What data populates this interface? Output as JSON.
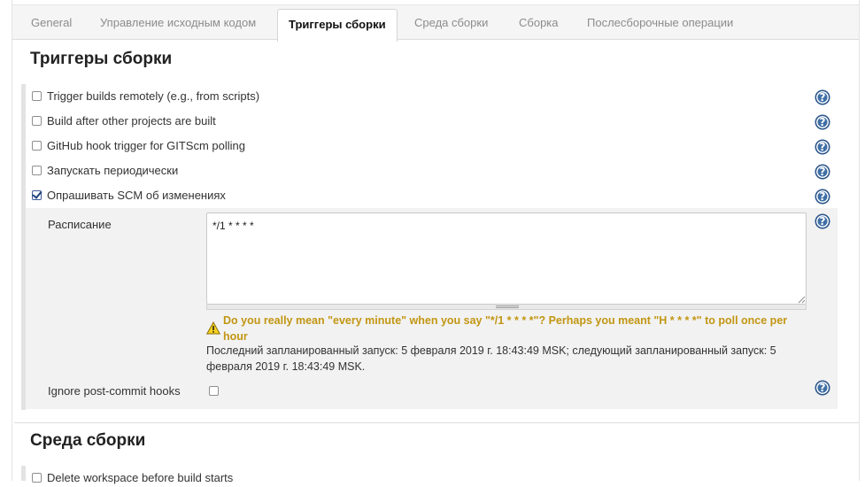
{
  "tabs": [
    {
      "label": "General"
    },
    {
      "label": "Управление исходным кодом"
    },
    {
      "label": "Триггеры сборки",
      "active": true
    },
    {
      "label": "Среда сборки"
    },
    {
      "label": "Сборка"
    },
    {
      "label": "Послесборочные операции"
    }
  ],
  "triggers": {
    "title": "Триггеры сборки",
    "options": [
      {
        "label": "Trigger builds remotely (e.g., from scripts)",
        "checked": false
      },
      {
        "label": "Build after other projects are built",
        "checked": false
      },
      {
        "label": "GitHub hook trigger for GITScm polling",
        "checked": false
      },
      {
        "label": "Запускать периодически",
        "checked": false
      },
      {
        "label": "Опрашивать SCM об изменениях",
        "checked": true
      }
    ],
    "poll_scm": {
      "schedule_label": "Расписание",
      "schedule_value": "*/1 * * * *",
      "warning": "Do you really mean \"every minute\" when you say \"*/1 * * * *\"? Perhaps you meant \"H * * * *\" to poll once per hour",
      "info": "Последний запланированный запуск: 5 февраля 2019 г. 18:43:49 MSK; следующий запланированный запуск: 5 февраля 2019 г. 18:43:49 MSK.",
      "ignore_hooks_label": "Ignore post-commit hooks",
      "ignore_hooks_checked": false
    }
  },
  "environment": {
    "title": "Среда сборки",
    "options": [
      {
        "label": "Delete workspace before build starts",
        "checked": false
      }
    ]
  },
  "icons": {
    "help": "help-icon",
    "help_glyph": "?",
    "warning": "warning-icon",
    "checkbox_checked": "checkmark-icon"
  },
  "colors": {
    "warning_text": "#c29613",
    "help_icon": "#3f6fa6",
    "active_tab_text": "#111111",
    "inactive_tab_text": "#8c8c8c"
  }
}
